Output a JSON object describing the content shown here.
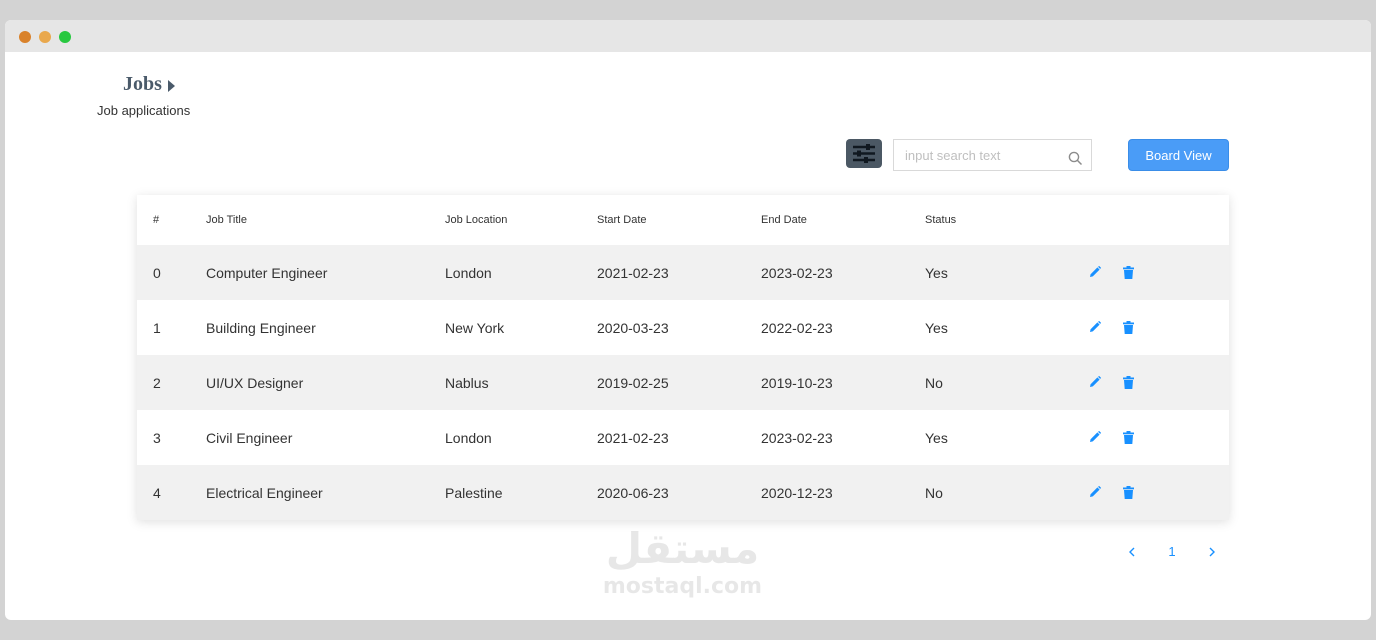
{
  "window": {
    "controls": {
      "red": "#d9822b",
      "yellow": "#e9a84d",
      "green": "#28c840"
    }
  },
  "header": {
    "title": "Jobs",
    "subtitle": "Job applications"
  },
  "toolbar": {
    "filter_icon": "sliders-icon",
    "search_placeholder": "input search text",
    "search_value": "",
    "board_view_label": "Board View"
  },
  "table": {
    "columns": [
      "#",
      "Job Title",
      "Job Location",
      "Start Date",
      "End Date",
      "Status"
    ],
    "rows": [
      {
        "index": "0",
        "title": "Computer Engineer",
        "location": "London",
        "start": "2021-02-23",
        "end": "2023-02-23",
        "status": "Yes"
      },
      {
        "index": "1",
        "title": "Building Engineer",
        "location": "New York",
        "start": "2020-03-23",
        "end": "2022-02-23",
        "status": "Yes"
      },
      {
        "index": "2",
        "title": "UI/UX Designer",
        "location": "Nablus",
        "start": "2019-02-25",
        "end": "2019-10-23",
        "status": "No"
      },
      {
        "index": "3",
        "title": "Civil Engineer",
        "location": "London",
        "start": "2021-02-23",
        "end": "2023-02-23",
        "status": "Yes"
      },
      {
        "index": "4",
        "title": "Electrical Engineer",
        "location": "Palestine",
        "start": "2020-06-23",
        "end": "2020-12-23",
        "status": "No"
      }
    ],
    "row_actions": [
      "edit-icon",
      "delete-icon"
    ]
  },
  "pagination": {
    "current_page": "1"
  },
  "watermark": {
    "arabic": "مستقل",
    "latin": "mostaql.com"
  },
  "colors": {
    "accent": "#4a9cf7",
    "action_icon": "#1890ff",
    "filter_button": "#4b5864",
    "heading": "#4a5a6a",
    "striped_row": "#f1f1f1"
  }
}
